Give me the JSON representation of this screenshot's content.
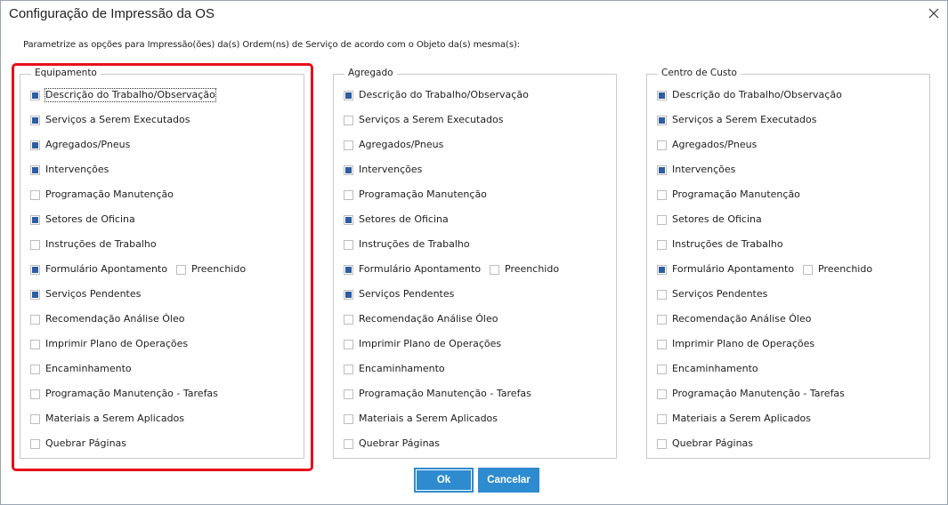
{
  "window": {
    "title": "Configuração de Impressão da OS"
  },
  "intro": "Parametrize as opções para Impressão(ões) da(s) Ordem(ns) de Serviço de acordo com o Objeto da(s) mesma(s):",
  "colors": {
    "checked": "#2d5da2",
    "button": "#2e8bd0",
    "highlight": "#e8101b"
  },
  "groups": [
    {
      "legend": "Equipamento",
      "items": [
        {
          "label": "Descrição do Trabalho/Observação",
          "checked": true
        },
        {
          "label": "Serviços a Serem Executados",
          "checked": true
        },
        {
          "label": "Agregados/Pneus",
          "checked": true
        },
        {
          "label": "Intervenções",
          "checked": true
        },
        {
          "label": "Programação Manutenção",
          "checked": false
        },
        {
          "label": "Setores de Oficina",
          "checked": true
        },
        {
          "label": "Instruções de Trabalho",
          "checked": false
        },
        {
          "label": "Formulário Apontamento",
          "checked": true,
          "sub": {
            "label": "Preenchido",
            "checked": false
          }
        },
        {
          "label": "Serviços Pendentes",
          "checked": true
        },
        {
          "label": "Recomendação Análise Óleo",
          "checked": false
        },
        {
          "label": "Imprimir Plano de Operações",
          "checked": false
        },
        {
          "label": "Encaminhamento",
          "checked": false
        },
        {
          "label": "Programação Manutenção - Tarefas",
          "checked": false
        },
        {
          "label": "Materiais a Serem Aplicados",
          "checked": false
        },
        {
          "label": "Quebrar Páginas",
          "checked": false
        }
      ]
    },
    {
      "legend": "Agregado",
      "items": [
        {
          "label": "Descrição do Trabalho/Observação",
          "checked": true
        },
        {
          "label": "Serviços a Serem Executados",
          "checked": false
        },
        {
          "label": "Agregados/Pneus",
          "checked": false
        },
        {
          "label": "Intervenções",
          "checked": true
        },
        {
          "label": "Programação Manutenção",
          "checked": false
        },
        {
          "label": "Setores de Oficina",
          "checked": true
        },
        {
          "label": "Instruções de Trabalho",
          "checked": false
        },
        {
          "label": "Formulário Apontamento",
          "checked": true,
          "sub": {
            "label": "Preenchido",
            "checked": false
          }
        },
        {
          "label": "Serviços Pendentes",
          "checked": true
        },
        {
          "label": "Recomendação Análise Óleo",
          "checked": false
        },
        {
          "label": "Imprimir Plano de Operações",
          "checked": false
        },
        {
          "label": "Encaminhamento",
          "checked": false
        },
        {
          "label": "Programação Manutenção - Tarefas",
          "checked": false
        },
        {
          "label": "Materiais a Serem Aplicados",
          "checked": false
        },
        {
          "label": "Quebrar Páginas",
          "checked": false
        }
      ]
    },
    {
      "legend": "Centro de Custo",
      "items": [
        {
          "label": "Descrição do Trabalho/Observação",
          "checked": true
        },
        {
          "label": "Serviços a Serem Executados",
          "checked": true
        },
        {
          "label": "Agregados/Pneus",
          "checked": false
        },
        {
          "label": "Intervenções",
          "checked": true
        },
        {
          "label": "Programação Manutenção",
          "checked": false
        },
        {
          "label": "Setores de Oficina",
          "checked": false
        },
        {
          "label": "Instruções de Trabalho",
          "checked": false
        },
        {
          "label": "Formulário Apontamento",
          "checked": true,
          "sub": {
            "label": "Preenchido",
            "checked": false
          }
        },
        {
          "label": "Serviços Pendentes",
          "checked": false
        },
        {
          "label": "Recomendação Análise Óleo",
          "checked": false
        },
        {
          "label": "Imprimir Plano de Operações",
          "checked": false
        },
        {
          "label": "Encaminhamento",
          "checked": false
        },
        {
          "label": "Programação Manutenção - Tarefas",
          "checked": false
        },
        {
          "label": "Materiais a Serem Aplicados",
          "checked": false
        },
        {
          "label": "Quebrar Páginas",
          "checked": false
        }
      ]
    }
  ],
  "buttons": {
    "ok": "Ok",
    "cancel": "Cancelar"
  }
}
